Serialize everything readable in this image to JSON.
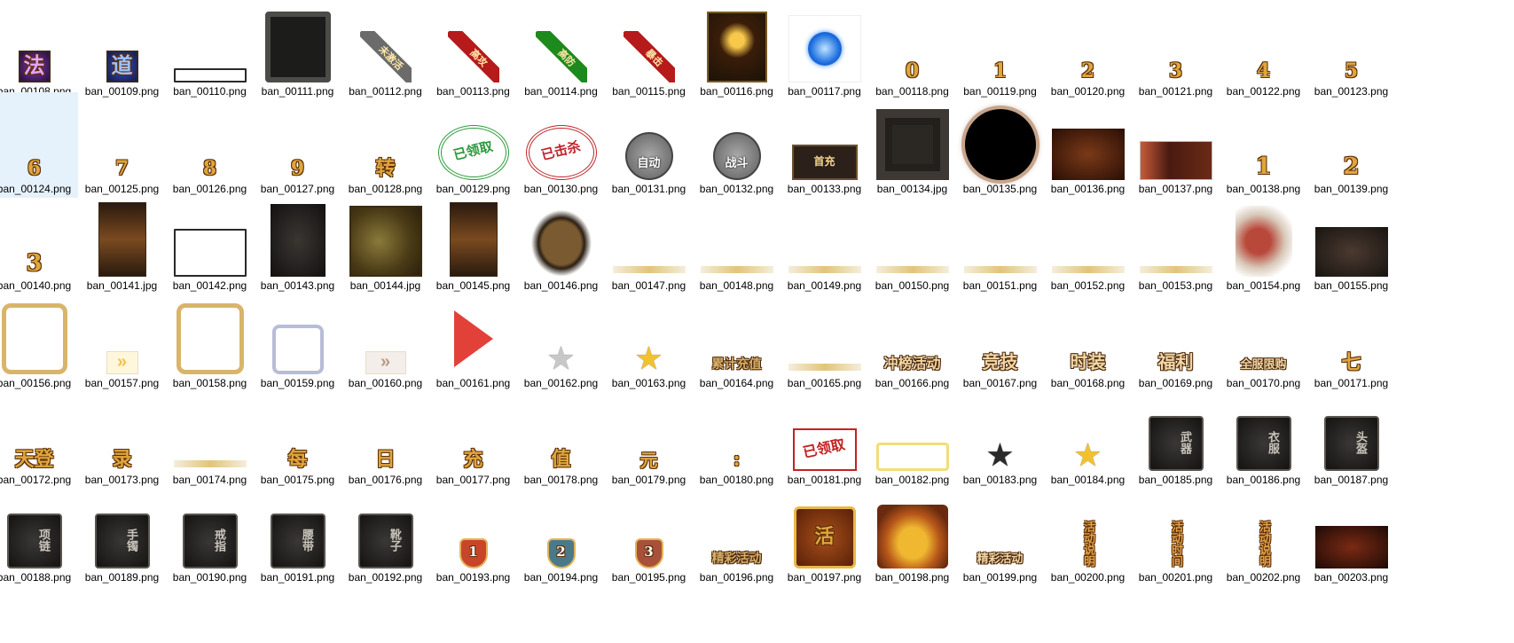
{
  "files": [
    {
      "name": "ban_00108.png",
      "icon": "purple-glyph-tile",
      "glyph": "法"
    },
    {
      "name": "ban_00109.png",
      "icon": "blue-glyph-tile",
      "glyph": "道"
    },
    {
      "name": "ban_00110.png",
      "icon": "empty-frame"
    },
    {
      "name": "ban_00111.png",
      "icon": "stone-frame"
    },
    {
      "name": "ban_00112.png",
      "icon": "corner-ribbon",
      "glyph": "未激活"
    },
    {
      "name": "ban_00113.png",
      "icon": "corner-ribbon",
      "glyph": "高攻"
    },
    {
      "name": "ban_00114.png",
      "icon": "corner-ribbon",
      "glyph": "高防"
    },
    {
      "name": "ban_00115.png",
      "icon": "corner-ribbon",
      "glyph": "暴击"
    },
    {
      "name": "ban_00116.png",
      "icon": "meditation-panel"
    },
    {
      "name": "ban_00117.png",
      "icon": "blue-orb"
    },
    {
      "name": "ban_00118.png",
      "icon": "digit",
      "glyph": "0"
    },
    {
      "name": "ban_00119.png",
      "icon": "digit",
      "glyph": "1"
    },
    {
      "name": "ban_00120.png",
      "icon": "digit",
      "glyph": "2"
    },
    {
      "name": "ban_00121.png",
      "icon": "digit",
      "glyph": "3"
    },
    {
      "name": "ban_00122.png",
      "icon": "digit",
      "glyph": "4"
    },
    {
      "name": "ban_00123.png",
      "icon": "digit",
      "glyph": "5"
    },
    {
      "name": "ban_00124.png",
      "icon": "digit",
      "glyph": "6"
    },
    {
      "name": "ban_00125.png",
      "icon": "digit",
      "glyph": "7"
    },
    {
      "name": "ban_00126.png",
      "icon": "digit",
      "glyph": "8"
    },
    {
      "name": "ban_00127.png",
      "icon": "digit",
      "glyph": "9"
    },
    {
      "name": "ban_00128.png",
      "icon": "glyph",
      "glyph": "转"
    },
    {
      "name": "ban_00129.png",
      "icon": "stamp",
      "glyph": "已领取"
    },
    {
      "name": "ban_00130.png",
      "icon": "stamp",
      "glyph": "已击杀"
    },
    {
      "name": "ban_00131.png",
      "icon": "round-button",
      "glyph": "自动"
    },
    {
      "name": "ban_00132.png",
      "icon": "round-button",
      "glyph": "战斗"
    },
    {
      "name": "ban_00133.png",
      "icon": "banner",
      "glyph": "首充"
    },
    {
      "name": "ban_00134.jpg",
      "icon": "octagon-frame"
    },
    {
      "name": "ban_00135.png",
      "icon": "dark-orb"
    },
    {
      "name": "ban_00136.png",
      "icon": "brown-panel"
    },
    {
      "name": "ban_00137.png",
      "icon": "character-banner"
    },
    {
      "name": "ban_00138.png",
      "icon": "digit",
      "glyph": "1"
    },
    {
      "name": "ban_00139.png",
      "icon": "digit",
      "glyph": "2"
    },
    {
      "name": "ban_00140.png",
      "icon": "digit",
      "glyph": "3"
    },
    {
      "name": "ban_00141.jpg",
      "icon": "tall-panel"
    },
    {
      "name": "ban_00142.png",
      "icon": "empty-frame"
    },
    {
      "name": "ban_00143.png",
      "icon": "dark-panel"
    },
    {
      "name": "ban_00144.jpg",
      "icon": "map-panel"
    },
    {
      "name": "ban_00145.png",
      "icon": "tall-panel"
    },
    {
      "name": "ban_00146.png",
      "icon": "warrior"
    },
    {
      "name": "ban_00147.png",
      "icon": "thin-bar"
    },
    {
      "name": "ban_00148.png",
      "icon": "thin-bar"
    },
    {
      "name": "ban_00149.png",
      "icon": "thin-bar"
    },
    {
      "name": "ban_00150.png",
      "icon": "thin-bar"
    },
    {
      "name": "ban_00151.png",
      "icon": "thin-bar"
    },
    {
      "name": "ban_00152.png",
      "icon": "thin-bar"
    },
    {
      "name": "ban_00153.png",
      "icon": "thin-bar"
    },
    {
      "name": "ban_00154.png",
      "icon": "character-portrait"
    },
    {
      "name": "ban_00155.png",
      "icon": "dark-panel"
    },
    {
      "name": "ban_00156.png",
      "icon": "gold-frame"
    },
    {
      "name": "ban_00157.png",
      "icon": "arrow-button"
    },
    {
      "name": "ban_00158.png",
      "icon": "gold-frame"
    },
    {
      "name": "ban_00159.png",
      "icon": "silver-frame"
    },
    {
      "name": "ban_00160.png",
      "icon": "arrow-button"
    },
    {
      "name": "ban_00161.png",
      "icon": "red-arrow"
    },
    {
      "name": "ban_00162.png",
      "icon": "star",
      "glyph": "★"
    },
    {
      "name": "ban_00163.png",
      "icon": "star",
      "glyph": "★"
    },
    {
      "name": "ban_00164.png",
      "icon": "label",
      "glyph": "累计充值"
    },
    {
      "name": "ban_00165.png",
      "icon": "thin-bar"
    },
    {
      "name": "ban_00166.png",
      "icon": "label",
      "glyph": "冲榜活动"
    },
    {
      "name": "ban_00167.png",
      "icon": "label",
      "glyph": "竞技"
    },
    {
      "name": "ban_00168.png",
      "icon": "label",
      "glyph": "时装"
    },
    {
      "name": "ban_00169.png",
      "icon": "label",
      "glyph": "福利"
    },
    {
      "name": "ban_00170.png",
      "icon": "label",
      "glyph": "全服限购"
    },
    {
      "name": "ban_00171.png",
      "icon": "glyph",
      "glyph": "七"
    },
    {
      "name": "ban_00172.png",
      "icon": "glyph",
      "glyph": "天登"
    },
    {
      "name": "ban_00173.png",
      "icon": "glyph",
      "glyph": "录"
    },
    {
      "name": "ban_00174.png",
      "icon": "thin-bar"
    },
    {
      "name": "ban_00175.png",
      "icon": "glyph",
      "glyph": "每"
    },
    {
      "name": "ban_00176.png",
      "icon": "glyph",
      "glyph": "日"
    },
    {
      "name": "ban_00177.png",
      "icon": "glyph",
      "glyph": "充"
    },
    {
      "name": "ban_00178.png",
      "icon": "glyph",
      "glyph": "值"
    },
    {
      "name": "ban_00179.png",
      "icon": "glyph",
      "glyph": "元"
    },
    {
      "name": "ban_00180.png",
      "icon": "glyph",
      "glyph": ":"
    },
    {
      "name": "ban_00181.png",
      "icon": "stamp",
      "glyph": "已领取"
    },
    {
      "name": "ban_00182.png",
      "icon": "empty-frame"
    },
    {
      "name": "ban_00183.png",
      "icon": "star",
      "glyph": "★"
    },
    {
      "name": "ban_00184.png",
      "icon": "star",
      "glyph": "★"
    },
    {
      "name": "ban_00185.png",
      "icon": "equip-slot",
      "glyph": "武器"
    },
    {
      "name": "ban_00186.png",
      "icon": "equip-slot",
      "glyph": "衣服"
    },
    {
      "name": "ban_00187.png",
      "icon": "equip-slot",
      "glyph": "头盔"
    },
    {
      "name": "ban_00188.png",
      "icon": "equip-slot",
      "glyph": "项链"
    },
    {
      "name": "ban_00189.png",
      "icon": "equip-slot",
      "glyph": "手镯"
    },
    {
      "name": "ban_00190.png",
      "icon": "equip-slot",
      "glyph": "戒指"
    },
    {
      "name": "ban_00191.png",
      "icon": "equip-slot",
      "glyph": "腰带"
    },
    {
      "name": "ban_00192.png",
      "icon": "equip-slot",
      "glyph": "靴子"
    },
    {
      "name": "ban_00193.png",
      "icon": "rank-badge",
      "glyph": "1"
    },
    {
      "name": "ban_00194.png",
      "icon": "rank-badge",
      "glyph": "2"
    },
    {
      "name": "ban_00195.png",
      "icon": "rank-badge",
      "glyph": "3"
    },
    {
      "name": "ban_00196.png",
      "icon": "label",
      "glyph": "精彩活动"
    },
    {
      "name": "ban_00197.png",
      "icon": "gold-badge",
      "glyph": "活"
    },
    {
      "name": "ban_00198.png",
      "icon": "treasure-chest"
    },
    {
      "name": "ban_00199.png",
      "icon": "label",
      "glyph": "精彩活动"
    },
    {
      "name": "ban_00200.png",
      "icon": "vertical-label",
      "glyph": "活动说明"
    },
    {
      "name": "ban_00201.png",
      "icon": "vertical-label",
      "glyph": "活动时间"
    },
    {
      "name": "ban_00202.png",
      "icon": "vertical-label",
      "glyph": "活动说明"
    },
    {
      "name": "ban_00203.png",
      "icon": "dark-panel"
    }
  ],
  "selected_index": 16,
  "colors": {
    "selection": "#e5f1fb",
    "gold": "#e0a63c",
    "dark": "#2a2420"
  }
}
